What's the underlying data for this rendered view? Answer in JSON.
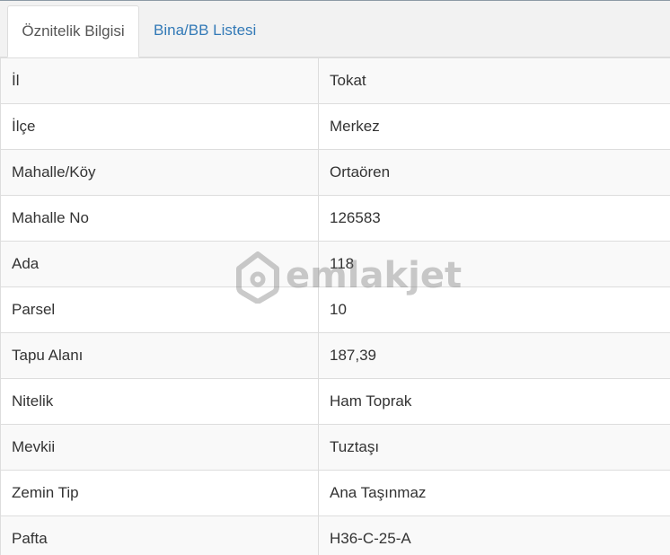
{
  "tabs": [
    {
      "label": "Öznitelik Bilgisi",
      "active": true
    },
    {
      "label": "Bina/BB Listesi",
      "active": false
    }
  ],
  "rows": [
    {
      "key": "İl",
      "value": "Tokat"
    },
    {
      "key": "İlçe",
      "value": "Merkez"
    },
    {
      "key": "Mahalle/Köy",
      "value": "Ortaören"
    },
    {
      "key": "Mahalle No",
      "value": "126583"
    },
    {
      "key": "Ada",
      "value": "118"
    },
    {
      "key": "Parsel",
      "value": "10"
    },
    {
      "key": "Tapu Alanı",
      "value": "187,39"
    },
    {
      "key": "Nitelik",
      "value": "Ham Toprak"
    },
    {
      "key": "Mevkii",
      "value": "Tuztaşı"
    },
    {
      "key": "Zemin Tip",
      "value": "Ana Taşınmaz"
    },
    {
      "key": "Pafta",
      "value": "H36-C-25-A"
    }
  ],
  "watermark": {
    "text": "emlakjet",
    "icon": "house-pin-icon"
  },
  "colors": {
    "link": "#337ab7",
    "text": "#333333",
    "border": "#dddddd",
    "stripe": "#f9f9f9"
  }
}
